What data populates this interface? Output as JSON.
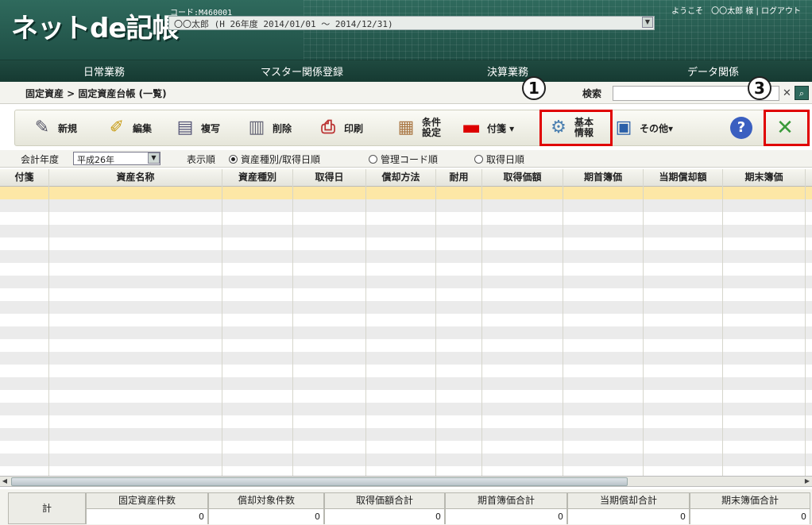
{
  "header": {
    "logo": "ネットde記帳",
    "code": "コード:M460001",
    "period": "〇〇太郎 (H 26年度 2014/01/01 ～ 2014/12/31)",
    "welcome": "ようこそ　〇〇太郎 様 | ログアウト"
  },
  "menu": [
    "日常業務",
    "マスター関係登録",
    "決算業務",
    "データ関係"
  ],
  "breadcrumb": "固定資産 > 固定資産台帳 (一覧)",
  "search": {
    "label": "検索",
    "value": ""
  },
  "toolbar": {
    "new": "新規",
    "edit": "編集",
    "copy": "複写",
    "delete": "削除",
    "print": "印刷",
    "cond1": "条件",
    "cond2": "設定",
    "tag": "付箋 ▾",
    "basic1": "基本",
    "basic2": "情報",
    "other": "その他▾"
  },
  "callouts": {
    "c1": "1",
    "c3": "3"
  },
  "options": {
    "year_label": "会計年度",
    "year_value": "平成26年",
    "order_label": "表示順",
    "order1": "資産種別/取得日順",
    "order2": "管理コード順",
    "order3": "取得日順"
  },
  "columns": [
    "付箋",
    "資産名称",
    "資産種別",
    "取得日",
    "償却方法",
    "耐用",
    "取得価額",
    "期首簿価",
    "当期償却額",
    "期末簿価"
  ],
  "footer": {
    "sum_label": "計",
    "cols": [
      {
        "label": "固定資産件数",
        "value": "0"
      },
      {
        "label": "償却対象件数",
        "value": "0"
      },
      {
        "label": "取得価額合計",
        "value": "0"
      },
      {
        "label": "期首簿価合計",
        "value": "0"
      },
      {
        "label": "当期償却合計",
        "value": "0"
      },
      {
        "label": "期末簿価合計",
        "value": "0"
      }
    ]
  },
  "colors": {
    "header": "#2f6a5d",
    "highlight_row": "#fde7a6",
    "callout_box": "#e00000"
  }
}
